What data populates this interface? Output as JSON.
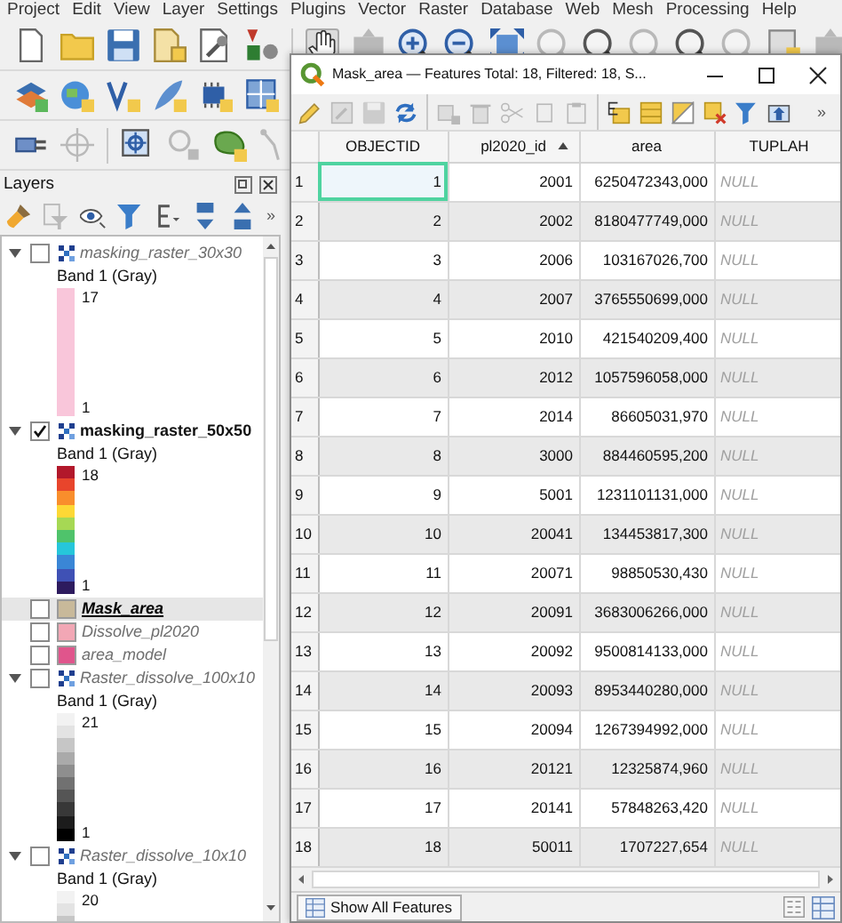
{
  "menu": [
    "Project",
    "Edit",
    "View",
    "Layer",
    "Settings",
    "Plugins",
    "Vector",
    "Raster",
    "Database",
    "Web",
    "Mesh",
    "Processing",
    "Help"
  ],
  "layers_panel": {
    "title": "Layers",
    "toolbar_overflow": "»",
    "layers": [
      {
        "kind": "raster",
        "name": "masking_raster_30x30",
        "checked": false,
        "selected": false,
        "expanded": true,
        "band": "Band 1 (Gray)",
        "ramp": [
          {
            "color": "#f9c6da"
          }
        ],
        "max": "17",
        "min": "1"
      },
      {
        "kind": "raster",
        "name": "masking_raster_50x50",
        "checked": true,
        "selected": false,
        "expanded": true,
        "band": "Band 1 (Gray)",
        "ramp": [
          {
            "color": "#b2182b"
          },
          {
            "color": "#e8452c"
          },
          {
            "color": "#f98e2c"
          },
          {
            "color": "#fdd835"
          },
          {
            "color": "#a6d854"
          },
          {
            "color": "#4fc36b"
          },
          {
            "color": "#26c6da"
          },
          {
            "color": "#3a86d6"
          },
          {
            "color": "#3f51b5"
          },
          {
            "color": "#2d1b5e"
          }
        ],
        "max": "18",
        "min": "1"
      },
      {
        "kind": "vector",
        "name": "Mask_area",
        "checked": false,
        "selected": true,
        "color": "#c8b99a"
      },
      {
        "kind": "vector",
        "name": "Dissolve_pl2020",
        "checked": false,
        "selected": false,
        "color": "#f2a7b5"
      },
      {
        "kind": "vector",
        "name": "area_model",
        "checked": false,
        "selected": false,
        "color": "#e0558c"
      },
      {
        "kind": "raster",
        "name": "Raster_dissolve_100x10",
        "checked": false,
        "selected": false,
        "expanded": true,
        "band": "Band 1 (Gray)",
        "ramp": [
          {
            "color": "#f2f2f2"
          },
          {
            "color": "#e3e3e3"
          },
          {
            "color": "#c6c6c6"
          },
          {
            "color": "#aaaaaa"
          },
          {
            "color": "#8e8e8e"
          },
          {
            "color": "#717171"
          },
          {
            "color": "#555555"
          },
          {
            "color": "#383838"
          },
          {
            "color": "#1c1c1c"
          },
          {
            "color": "#000000"
          }
        ],
        "max": "21",
        "min": "1"
      },
      {
        "kind": "raster",
        "name": "Raster_dissolve_10x10",
        "checked": false,
        "selected": false,
        "expanded": true,
        "band": "Band 1 (Gray)",
        "ramp": [
          {
            "color": "#f2f2f2"
          },
          {
            "color": "#e3e3e3"
          },
          {
            "color": "#c6c6c6"
          }
        ],
        "max": "20"
      }
    ]
  },
  "attribute_table": {
    "title": "Mask_area — Features Total: 18, Filtered: 18, S...",
    "toolbar_overflow": "»",
    "columns": [
      {
        "label": "OBJECTID",
        "kind": "number",
        "sorted": false
      },
      {
        "label": "pl2020_id",
        "kind": "number",
        "sorted": true
      },
      {
        "label": "area",
        "kind": "number",
        "sorted": false
      },
      {
        "label": "TUPLAH",
        "kind": "empty",
        "sorted": false
      }
    ],
    "rows": [
      {
        "number": "1",
        "focused": true,
        "cells": [
          "1",
          "2001",
          "6250472343,000",
          "NULL"
        ]
      },
      {
        "number": "2",
        "focused": false,
        "cells": [
          "2",
          "2002",
          "8180477749,000",
          "NULL"
        ]
      },
      {
        "number": "3",
        "focused": false,
        "cells": [
          "3",
          "2006",
          "103167026,700",
          "NULL"
        ]
      },
      {
        "number": "4",
        "focused": false,
        "cells": [
          "4",
          "2007",
          "3765550699,000",
          "NULL"
        ]
      },
      {
        "number": "5",
        "focused": false,
        "cells": [
          "5",
          "2010",
          "421540209,400",
          "NULL"
        ]
      },
      {
        "number": "6",
        "focused": false,
        "cells": [
          "6",
          "2012",
          "1057596058,000",
          "NULL"
        ]
      },
      {
        "number": "7",
        "focused": false,
        "cells": [
          "7",
          "2014",
          "86605031,970",
          "NULL"
        ]
      },
      {
        "number": "8",
        "focused": false,
        "cells": [
          "8",
          "3000",
          "884460595,200",
          "NULL"
        ]
      },
      {
        "number": "9",
        "focused": false,
        "cells": [
          "9",
          "5001",
          "1231101131,000",
          "NULL"
        ]
      },
      {
        "number": "10",
        "focused": false,
        "cells": [
          "10",
          "20041",
          "134453817,300",
          "NULL"
        ]
      },
      {
        "number": "11",
        "focused": false,
        "cells": [
          "11",
          "20071",
          "98850530,430",
          "NULL"
        ]
      },
      {
        "number": "12",
        "focused": false,
        "cells": [
          "12",
          "20091",
          "3683006266,000",
          "NULL"
        ]
      },
      {
        "number": "13",
        "focused": false,
        "cells": [
          "13",
          "20092",
          "9500814133,000",
          "NULL"
        ]
      },
      {
        "number": "14",
        "focused": false,
        "cells": [
          "14",
          "20093",
          "8953440280,000",
          "NULL"
        ]
      },
      {
        "number": "15",
        "focused": false,
        "cells": [
          "15",
          "20094",
          "1267394992,000",
          "NULL"
        ]
      },
      {
        "number": "16",
        "focused": false,
        "cells": [
          "16",
          "20121",
          "12325874,960",
          "NULL"
        ]
      },
      {
        "number": "17",
        "focused": false,
        "cells": [
          "17",
          "20141",
          "57848263,420",
          "NULL"
        ]
      },
      {
        "number": "18",
        "focused": false,
        "cells": [
          "18",
          "50011",
          "1707227,654",
          "NULL"
        ]
      }
    ],
    "show_all_button": "Show All Features"
  }
}
